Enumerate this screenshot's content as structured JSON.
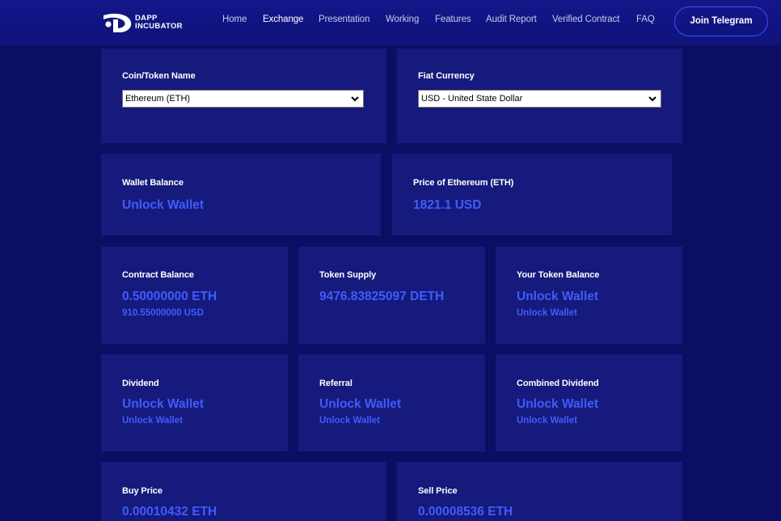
{
  "brand": {
    "line1": "DAPP",
    "line2": "INCUBATOR"
  },
  "nav": {
    "items": [
      "Home",
      "Exchange",
      "Presentation",
      "Working",
      "Features",
      "Audit Report",
      "Verified Contract",
      "FAQ"
    ],
    "active": "Exchange",
    "cta": "Join Telegram"
  },
  "selectors": {
    "coin": {
      "label": "Coin/Token Name",
      "value": "Ethereum (ETH)"
    },
    "fiat": {
      "label": "Fiat Currency",
      "value": "USD - United State Dollar"
    }
  },
  "wallet_balance": {
    "label": "Wallet Balance",
    "value": "Unlock Wallet"
  },
  "price": {
    "label": "Price of Ethereum (ETH)",
    "value": "1821.1 USD"
  },
  "contract_balance": {
    "label": "Contract Balance",
    "value": "0.50000000 ETH",
    "sub": "910.55000000 USD"
  },
  "token_supply": {
    "label": "Token Supply",
    "value": "9476.83825097 DETH"
  },
  "your_token_balance": {
    "label": "Your Token Balance",
    "value": "Unlock Wallet",
    "sub": "Unlock Wallet"
  },
  "dividend": {
    "label": "Dividend",
    "value": "Unlock Wallet",
    "sub": "Unlock Wallet"
  },
  "referral": {
    "label": "Referral",
    "value": "Unlock Wallet",
    "sub": "Unlock Wallet"
  },
  "combined_dividend": {
    "label": "Combined Dividend",
    "value": "Unlock Wallet",
    "sub": "Unlock Wallet"
  },
  "buy_price": {
    "label": "Buy Price",
    "value": "0.00010432 ETH"
  },
  "sell_price": {
    "label": "Sell Price",
    "value": "0.00008536 ETH"
  },
  "colors": {
    "background": "#0c0e63",
    "card": "#161a7c",
    "accent": "#3f5cff",
    "button_border": "#3a4fff"
  }
}
